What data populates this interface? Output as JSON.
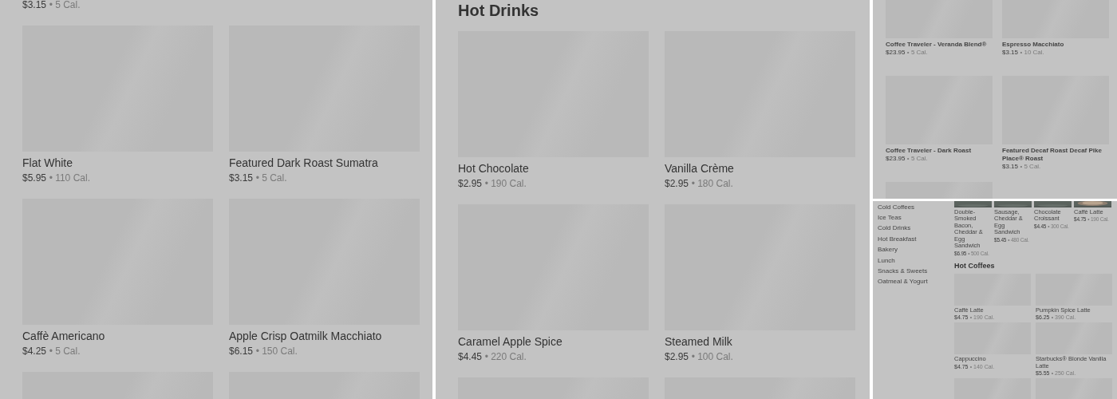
{
  "panels": [
    {
      "kind": "large",
      "sections": [
        {
          "cards": [
            {
              "price": "$3.15",
              "calories": "• 5 Cal."
            }
          ]
        },
        {
          "cards": [
            {
              "name": "Flat White",
              "price": "$5.95",
              "calories": "• 110 Cal."
            },
            {
              "name": "Featured Dark Roast Sumatra",
              "price": "$3.15",
              "calories": "• 5 Cal."
            },
            {
              "name": "Caffè Americano",
              "price": "$4.25",
              "calories": "• 5 Cal."
            },
            {
              "name": "Apple Crisp Oatmilk Macchiato",
              "price": "$6.15",
              "calories": "• 150 Cal."
            },
            {
              "kind": "placeholder"
            },
            {
              "kind": "placeholder"
            }
          ]
        }
      ]
    },
    {
      "kind": "large",
      "sections": [
        {
          "heading": "Hot Drinks",
          "cards": [
            {
              "name": "Hot Chocolate",
              "price": "$2.95",
              "calories": "• 190 Cal."
            },
            {
              "name": "Vanilla Crème",
              "price": "$2.95",
              "calories": "• 180 Cal."
            },
            {
              "name": "Caramel Apple Spice",
              "price": "$4.45",
              "calories": "• 220 Cal."
            },
            {
              "name": "Steamed Milk",
              "price": "$2.95",
              "calories": "• 100 Cal."
            },
            {
              "kind": "placeholder"
            },
            {
              "kind": "placeholder"
            }
          ]
        }
      ]
    },
    {
      "kind": "small",
      "sections": [
        {
          "cards": [
            {
              "name": "Coffee Traveler - Veranda Blend®",
              "price": "$23.95",
              "calories": "• 5 Cal."
            },
            {
              "name": "Espresso Macchiato",
              "price": "$3.15",
              "calories": "• 10 Cal."
            },
            {
              "name": "Coffee Traveler - Dark Roast",
              "price": "$23.95",
              "calories": "• 5 Cal."
            },
            {
              "name": "Featured Decaf Roast Decaf Pike Place® Roast",
              "price": "$3.15",
              "calories": "• 5 Cal."
            },
            {
              "kind": "placeholder"
            }
          ]
        }
      ]
    },
    {
      "kind": "sidebar",
      "sidebar": [
        "Cold Coffees",
        "Ice Teas",
        "Cold Drinks",
        "Hot Breakfast",
        "Bakery",
        "Lunch",
        "Snacks & Sweets",
        "Oatmeal & Yogurt"
      ],
      "sections": [
        {
          "cards": [
            {
              "name": "Double-Smoked Bacon, Cheddar & Egg Sandwich",
              "price": "$6.95",
              "calories": "• 500 Cal."
            },
            {
              "name": "Sausage, Cheddar & Egg Sandwich",
              "price": "$5.45",
              "calories": "• 480 Cal."
            },
            {
              "name": "Chocolate Croissant",
              "price": "$4.45",
              "calories": "• 300 Cal."
            },
            {
              "name": "Caffè Latte",
              "price": "$4.75",
              "calories": "• 190 Cal.",
              "kind": "cup"
            }
          ]
        },
        {
          "heading": "Hot Coffees",
          "cards": [
            {
              "name": "Caffè Latte",
              "price": "$4.75",
              "calories": "• 190 Cal."
            },
            {
              "name": "Pumpkin Spice Latte",
              "price": "$6.25",
              "calories": "• 390 Cal."
            },
            {
              "name": "Cappuccino",
              "price": "$4.75",
              "calories": "• 140 Cal."
            },
            {
              "name": "Starbucks® Blonde Vanilla Latte",
              "price": "$5.55",
              "calories": "• 250 Cal."
            },
            {
              "kind": "placeholder"
            },
            {
              "kind": "placeholder"
            }
          ]
        }
      ]
    }
  ]
}
